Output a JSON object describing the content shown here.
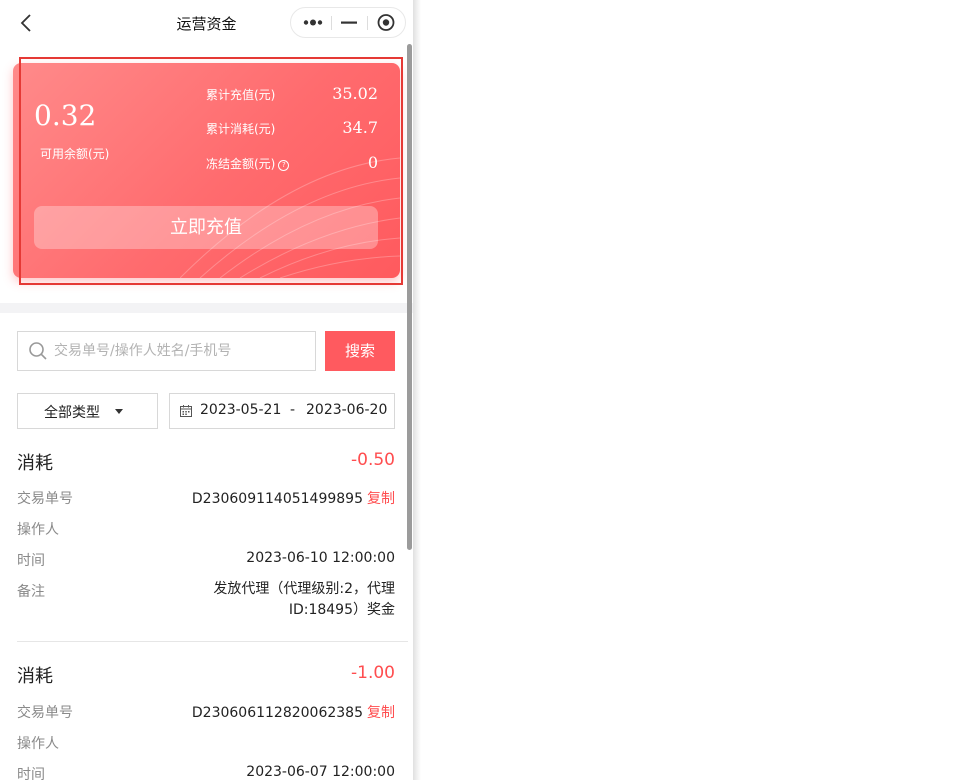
{
  "nav": {
    "title": "运营资金",
    "back_icon": "chevron-left-icon",
    "capsule_icons": [
      "more-dots-icon",
      "minimize-icon",
      "target-icon"
    ]
  },
  "card": {
    "balance": "0.32",
    "balance_label": "可用余额(元)",
    "stats": [
      {
        "label": "累计充值(元)",
        "value": "35.02"
      },
      {
        "label": "累计消耗(元)",
        "value": "34.7"
      },
      {
        "label": "冻结金额(元)",
        "value": "0",
        "help_icon": "question-circle-icon",
        "help_glyph": "?"
      }
    ],
    "recharge_label": "立即充值",
    "gradient_colors": [
      "#ff8a8a",
      "#ff5a5e"
    ]
  },
  "search": {
    "placeholder": "交易单号/操作人姓名/手机号",
    "value": "",
    "button_label": "搜索",
    "accent": "#ff5a5f"
  },
  "filters": {
    "type_label": "全部类型",
    "date_start": "2023-05-21",
    "date_sep": "-",
    "date_end": "2023-06-20"
  },
  "records": [
    {
      "type": "消耗",
      "amount": "-0.50",
      "order_label": "交易单号",
      "order_no": "D230609114051499895",
      "copy_label": "复制",
      "operator_label": "操作人",
      "operator": "",
      "time_label": "时间",
      "time": "2023-06-10 12:00:00",
      "note_label": "备注",
      "note": "发放代理（代理级别:2，代理ID:18495）奖金"
    },
    {
      "type": "消耗",
      "amount": "-1.00",
      "order_label": "交易单号",
      "order_no": "D230606112820062385",
      "copy_label": "复制",
      "operator_label": "操作人",
      "operator": "",
      "time_label": "时间",
      "time": "2023-06-07 12:00:00"
    }
  ]
}
